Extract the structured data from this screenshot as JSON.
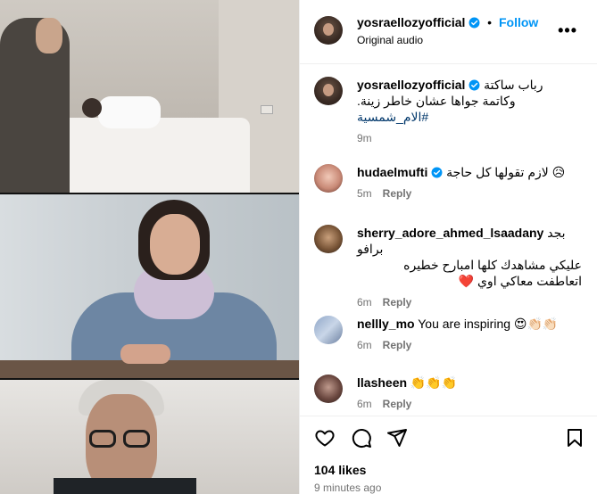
{
  "post": {
    "username": "yosraellozyofficial",
    "follow_label": "Follow",
    "dot": "•",
    "audio": "Original audio",
    "more_label": "•••"
  },
  "caption": {
    "username": "yosraellozyofficial",
    "line1": "رباب ساكتة",
    "line2": "وكاتمة جواها عشان خاطر زينة.",
    "hashtag": "#الام_شمسية",
    "time": "9m"
  },
  "comments": [
    {
      "username": "hudaelmufti",
      "verified": true,
      "text": "لازم تقولها كل حاجة 😥",
      "time": "5m",
      "reply": "Reply"
    },
    {
      "username": "sherry_adore_ahmed_lsaadany",
      "verified": false,
      "text_first": "بجد برافو",
      "text": "عليكي مشاهدك كلها امبارح خطيره اتعاطفت معاكي اوي ❤️",
      "time": "6m",
      "reply": "Reply"
    },
    {
      "username": "nellly_mo",
      "verified": false,
      "text": "You are inspiring 😍👏🏻👏🏻",
      "time": "6m",
      "reply": "Reply"
    },
    {
      "username": "llasheen",
      "verified": false,
      "text": "👏👏👏",
      "time": "6m",
      "reply": "Reply"
    }
  ],
  "footer": {
    "likes": "104 likes",
    "time_ago": "9 minutes ago"
  },
  "icons": [
    "heart-icon",
    "comment-icon",
    "share-icon",
    "bookmark-icon",
    "verified-icon",
    "more-icon"
  ],
  "colors": {
    "accent": "#0095f6",
    "meta": "#737373",
    "hashtag": "#00376b"
  }
}
